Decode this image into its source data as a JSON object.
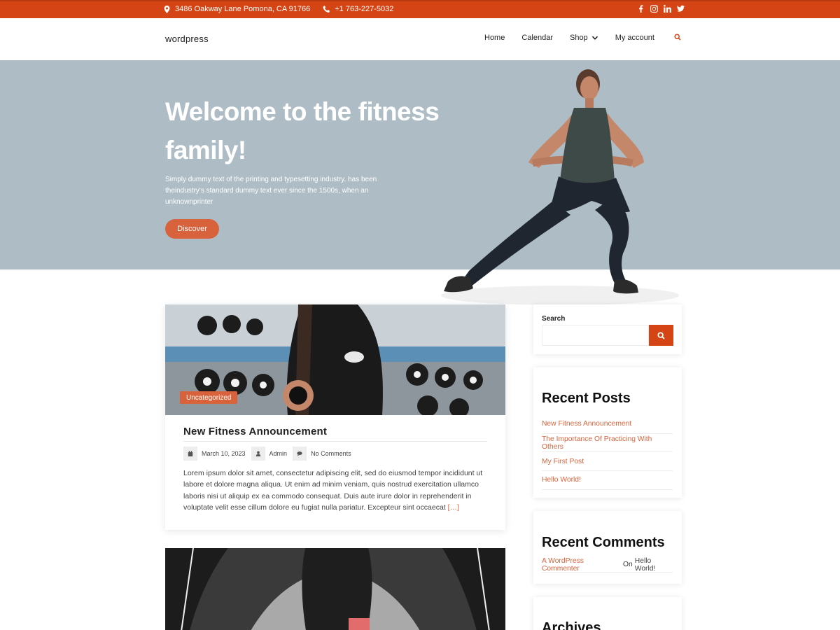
{
  "topbar": {
    "address": "3486 Oakway Lane Pomona, CA 91766",
    "phone": "+1 763-227-5032",
    "socials": [
      "facebook-icon",
      "instagram-icon",
      "linkedin-icon",
      "twitter-icon"
    ]
  },
  "header": {
    "site_title": "wordpress",
    "nav": [
      {
        "label": "Home"
      },
      {
        "label": "Calendar"
      },
      {
        "label": "Shop"
      },
      {
        "label": "My account"
      }
    ]
  },
  "hero": {
    "title": "Welcome to the fitness family!",
    "text": "Simply dummy text of the printing and typesetting industry. has been theindustry's standard dummy text ever since the 1500s, when an unknownprinter",
    "button": "Discover"
  },
  "post": {
    "category": "Uncategorized",
    "title": "New Fitness Announcement",
    "date": "March 10, 2023",
    "author": "Admin",
    "comments": "No Comments",
    "excerpt": "Lorem ipsum dolor sit amet, consectetur adipiscing elit, sed do eiusmod tempor incididunt ut labore et dolore magna aliqua. Ut enim ad minim veniam, quis nostrud exercitation ullamco laboris nisi ut aliquip ex ea commodo consequat. Duis aute irure dolor in reprehenderit in voluptate velit esse cillum dolore eu fugiat nulla pariatur. Excepteur sint occaecat",
    "more": "[…]"
  },
  "sidebar": {
    "search": {
      "label": "Search",
      "placeholder": ""
    },
    "recent_posts": {
      "title": "Recent Posts",
      "items": [
        "New Fitness Announcement",
        "The Importance Of Practicing With Others",
        "My First Post",
        "Hello World!"
      ]
    },
    "recent_comments": {
      "title": "Recent Comments",
      "author": "A WordPress Commenter",
      "on": "On",
      "post": "Hello World!"
    },
    "archives": {
      "title": "Archives"
    }
  },
  "colors": {
    "accent": "#d54414",
    "button": "#d8623b",
    "hero_bg": "#aebcc5"
  }
}
